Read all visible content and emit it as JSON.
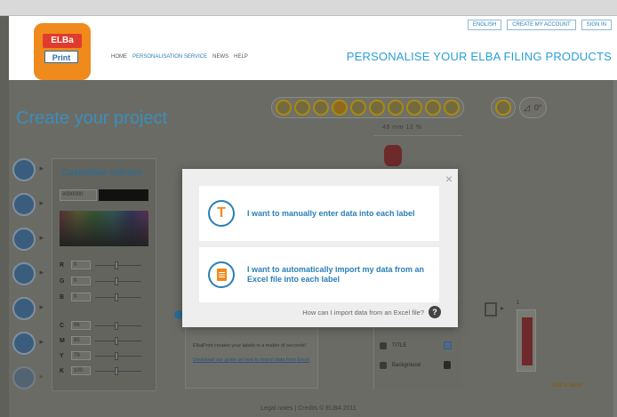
{
  "top_links": [
    "ENGLISH",
    "CREATE MY ACCOUNT",
    "SIGN IN"
  ],
  "logo": {
    "brand": "ELBa",
    "product": "Print"
  },
  "nav": [
    {
      "label": "HOME",
      "active": false
    },
    {
      "label": "PERSONALISATION SERVICE",
      "active": true
    },
    {
      "label": "NEWS",
      "active": false
    },
    {
      "label": "HELP",
      "active": false
    }
  ],
  "headline": "PERSONALISE YOUR ELBA FILING PRODUCTS",
  "page_title": "Create your project",
  "toolbar": {
    "tools": [
      "align-left-icon",
      "align-center-icon",
      "crop-icon",
      "pointer-icon",
      "hand-icon",
      "grid-icon",
      "zoom-in-icon",
      "zoom-out-icon",
      "refresh-icon",
      "copy-icon"
    ],
    "active_tool_index": 3,
    "rotate_value": "0°"
  },
  "dimensions": "48 mm  13 %",
  "colour_panel": {
    "title": "Customise colours",
    "hex": "#000000",
    "rgb": [
      {
        "label": "R",
        "value": "0"
      },
      {
        "label": "G",
        "value": "0"
      },
      {
        "label": "B",
        "value": "0"
      }
    ],
    "cmyk": [
      {
        "label": "C",
        "value": "86"
      },
      {
        "label": "M",
        "value": "85"
      },
      {
        "label": "Y",
        "value": "79"
      },
      {
        "label": "K",
        "value": "100"
      }
    ]
  },
  "help_box": {
    "text": "ElbaPrint creates your labels in a matter of seconds!",
    "link": "Download our guide on how to import data from Excel"
  },
  "layers": [
    {
      "label": "TITLE"
    },
    {
      "label": "Background"
    }
  ],
  "thumbnail_number": "1",
  "add_label": "Add a label",
  "footer": "Legal notes  |  Credits © ELBA 2011",
  "modal": {
    "close_symbol": "×",
    "option_manual": {
      "icon_letter": "T",
      "text": "I want to manually enter data into each label"
    },
    "option_excel": {
      "text": "I want to automatically import my data from an Excel file into each label"
    },
    "faq_text": "How can I import data from an Excel file?",
    "faq_symbol": "?"
  }
}
